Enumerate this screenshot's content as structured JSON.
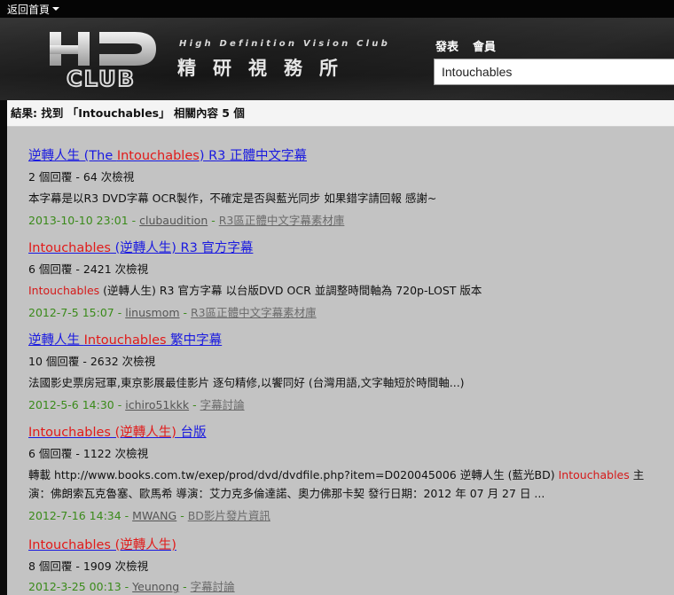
{
  "topbar": {
    "home_label": "返回首頁"
  },
  "header": {
    "tagline": "High Definition Vision Club",
    "title_cn": "精研視務所",
    "nav": [
      "發表",
      "會員"
    ],
    "search_value": "Intouchables",
    "logo_top": "HD",
    "logo_bottom": "CLUB"
  },
  "results": {
    "summary": "結果: 找到 「Intouchables」 相關內容 5 個",
    "items": [
      {
        "title": [
          "逆轉人生 (The ",
          "Intouchables",
          ") R3 正體中文字幕"
        ],
        "meta": "2 個回覆 - 64 次檢視",
        "snippet": [
          "本字幕是以R3 DVD字幕 OCR製作，不確定是否與藍光同步 如果錯字請回報 感謝~"
        ],
        "date": "2013-10-10 23:01",
        "user": "clubaudition",
        "category": "R3區正體中文字幕素材庫"
      },
      {
        "title": [
          "",
          "Intouchables",
          " (逆轉人生) R3 官方字幕"
        ],
        "meta": "6 個回覆 - 2421 次檢視",
        "snippet": [
          "",
          "Intouchables",
          " (逆轉人生) R3 官方字幕 以台版DVD OCR 並調整時間軸為 720p-LOST 版本"
        ],
        "date": "2012-7-5 15:07",
        "user": "linusmom",
        "category": "R3區正體中文字幕素材庫"
      },
      {
        "title": [
          "逆轉人生 ",
          "Intouchables",
          " 繁中字幕"
        ],
        "meta": "10 個回覆 - 2632 次檢視",
        "snippet": [
          "法國影史票房冠軍,東京影展最佳影片 逐句精修,以饗同好 (台灣用語,文字軸短於時間軸...)"
        ],
        "date": "2012-5-6 14:30",
        "user": "ichiro51kkk",
        "category": "字幕討論"
      },
      {
        "title": [
          "",
          "Intouchables (逆轉人生)",
          " 台版"
        ],
        "meta": "6 個回覆 - 1122 次檢視",
        "snippet": [
          "轉載 http://www.books.com.tw/exep/prod/dvd/dvdfile.php?item=D020045006 逆轉人生 (藍光BD) ",
          "Intouchables",
          " 主演：佛朗索瓦克魯塞、歐馬希 導演：艾力克多倫達諾、奧力佛那卡契 發行日期：2012 年 07 月 27 日 ..."
        ],
        "date": "2012-7-16 14:34",
        "user": "MWANG",
        "category": "BD影片發片資訊"
      },
      {
        "title": [
          "",
          "Intouchables (逆轉人生)",
          ""
        ],
        "meta": "8 個回覆 - 1909 次檢視",
        "snippet": [],
        "date": "2012-3-25 00:13",
        "user": "Yeunong",
        "category": "字幕討論"
      }
    ]
  }
}
